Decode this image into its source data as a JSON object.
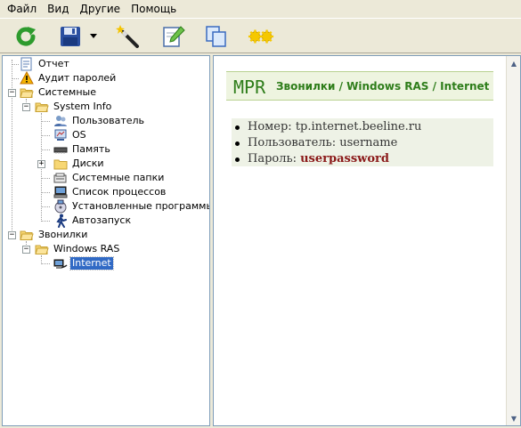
{
  "menu": {
    "items": [
      {
        "label": "Файл"
      },
      {
        "label": "Вид"
      },
      {
        "label": "Другие"
      },
      {
        "label": "Помощь"
      }
    ]
  },
  "toolbar": {
    "buttons": [
      {
        "name": "refresh-button",
        "icon": "refresh-icon",
        "color": "#2e9b2e"
      },
      {
        "name": "save-button",
        "icon": "floppy-disk-icon",
        "color": "#2a4fa0"
      },
      {
        "name": "save-dropdown-button",
        "icon": "dropdown-arrow-icon"
      },
      {
        "name": "wizard-button",
        "icon": "magic-wand-icon"
      },
      {
        "name": "edit-button",
        "icon": "pencil-document-icon"
      },
      {
        "name": "copy-button",
        "icon": "copy-windows-icon"
      },
      {
        "name": "options-button",
        "icon": "gears-icon",
        "color": "#e8b800"
      }
    ]
  },
  "tree": {
    "items": [
      {
        "label": "Отчет",
        "icon": "report-icon"
      },
      {
        "label": "Аудит паролей",
        "icon": "warning-icon"
      },
      {
        "label": "Системные",
        "icon": "folder-open-icon"
      },
      {
        "label": "System Info",
        "icon": "folder-open-icon"
      },
      {
        "label": "Пользователь",
        "icon": "users-icon"
      },
      {
        "label": "OS",
        "icon": "os-icon"
      },
      {
        "label": "Память",
        "icon": "memory-chip-icon"
      },
      {
        "label": "Диски",
        "icon": "folder-icon"
      },
      {
        "label": "Системные папки",
        "icon": "system-folders-icon"
      },
      {
        "label": "Список процессов",
        "icon": "process-list-icon"
      },
      {
        "label": "Установленные программы",
        "icon": "installed-programs-icon"
      },
      {
        "label": "Автозапуск",
        "icon": "autorun-icon"
      },
      {
        "label": "Звонилки",
        "icon": "folder-open-icon"
      },
      {
        "label": "Windows RAS",
        "icon": "folder-open-icon"
      },
      {
        "label": "Internet",
        "icon": "dialup-connection-icon",
        "selected": true
      }
    ]
  },
  "content": {
    "logo_text": "MPR",
    "header_title": "Звонилки / Windows RAS / Internet",
    "details": [
      {
        "label": "Номер:",
        "value": "tp.internet.beeline.ru"
      },
      {
        "label": "Пользователь:",
        "value": "username"
      },
      {
        "label": "Пароль:",
        "value": "userpassword"
      }
    ],
    "accent_color": "#2e7d1a",
    "password_color": "#8b1a1a"
  }
}
